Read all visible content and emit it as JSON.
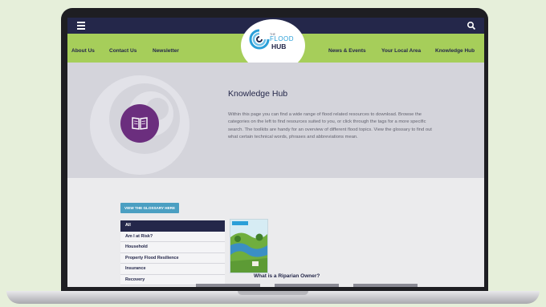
{
  "topbar": {
    "menu_icon": "hamburger-icon",
    "search_icon": "search-icon"
  },
  "nav": {
    "left": [
      "About Us",
      "Contact Us",
      "Newsletter"
    ],
    "right": [
      "News & Events",
      "Your Local Area",
      "Knowledge Hub"
    ]
  },
  "logo": {
    "small": "THE",
    "flood": "FLOOD",
    "hub": "HUB"
  },
  "hero": {
    "title": "Knowledge Hub",
    "description": "Within this page you can find a wide range of flood related resources to download. Browse the categories on the left to find resources suited to you, or click through the tags for a more specific search. The toolkits are handy for an overview of different flood topics. View the glossary to find out what certain technical words, phrases and abbreviations mean.",
    "icon": "book-icon"
  },
  "glossary_button": "VIEW THE GLOSSARY HERE",
  "categories": [
    "All",
    "Am I at Risk?",
    "Household",
    "Property Flood Resilience",
    "Insurance",
    "Recovery"
  ],
  "active_category": "All",
  "card": {
    "title": "What is a Riparian Owner?"
  },
  "colors": {
    "navy": "#24274a",
    "green": "#a6ce5a",
    "purple": "#6b2e7e",
    "blue": "#2a9fd8",
    "button": "#4b9fc2"
  }
}
